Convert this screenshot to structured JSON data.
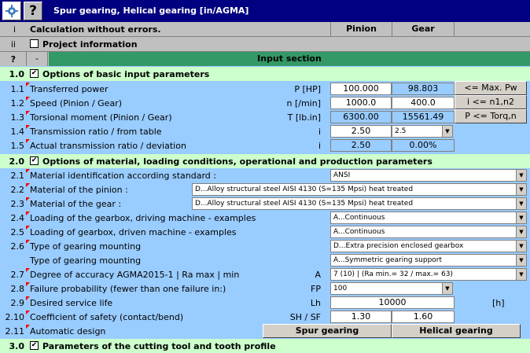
{
  "window": {
    "title": "Spur gearing, Helical gearing [in/AGMA]",
    "help_glyph": "?"
  },
  "status_row": {
    "num": "i",
    "text": "Calculation without errors.",
    "col_pinion": "Pinion",
    "col_gear": "Gear"
  },
  "project_row": {
    "num": "ii",
    "label": "Project information"
  },
  "input_row": {
    "num": "?",
    "dash": "-",
    "title": "Input section"
  },
  "section1": {
    "num": "1.0",
    "title": "Options of basic input parameters",
    "checked": "✔"
  },
  "rows1": [
    {
      "num": "1.1",
      "label": "Transferred power",
      "sym": "P [HP]",
      "pinion": "100.000",
      "gear": "98.803"
    },
    {
      "num": "1.2",
      "label": "Speed (Pinion / Gear)",
      "sym": "n [/min]",
      "pinion": "1000.0",
      "gear": "400.0"
    },
    {
      "num": "1.3",
      "label": "Torsional moment (Pinion / Gear)",
      "sym": "T [lb.in]",
      "pinion": "6300.00",
      "gear": "15561.49"
    },
    {
      "num": "1.4",
      "label": "Transmission ratio / from table",
      "sym": "i",
      "pinion": "2.50",
      "gear": "2.5"
    },
    {
      "num": "1.5",
      "label": "Actual transmission ratio / deviation",
      "sym": "i",
      "pinion": "2.50",
      "gear": "0.00%"
    }
  ],
  "side_buttons": [
    "<= Max. Pw",
    "i <= n1,n2",
    "P <= Torq,n"
  ],
  "section2": {
    "num": "2.0",
    "title": "Options of material, loading conditions, operational and production parameters",
    "checked": "✔"
  },
  "rows2": [
    {
      "num": "2.1",
      "label": "Material identification according standard :",
      "value": "ANSI"
    },
    {
      "num": "2.2",
      "label": "Material of the pinion :",
      "value": "D...Alloy structural steel AISI 4130  (S=135 Mpsi) heat treated"
    },
    {
      "num": "2.3",
      "label": "Material of the gear :",
      "value": "D...Alloy structural steel AISI 4130  (S=135 Mpsi) heat treated"
    },
    {
      "num": "2.4",
      "label": "Loading of the gearbox, driving machine - examples",
      "value": "A...Continuous"
    },
    {
      "num": "2.5",
      "label": "Loading of gearbox, driven machine - examples",
      "value": "A...Continuous"
    },
    {
      "num": "2.6",
      "label": "Type of gearing mounting",
      "value": "D...Extra precision enclosed gearbox"
    },
    {
      "num": "",
      "label": "Type of gearing mounting",
      "value": "A...Symmetric gearing support"
    },
    {
      "num": "2.7",
      "label": "Degree of accuracy AGMA2015-1 | Ra max | min",
      "sym": "A",
      "value": "7 (10)   |   (Ra min.= 32 / max.= 63)"
    },
    {
      "num": "2.8",
      "label": "Failure probability (fewer than one failure in:)",
      "sym": "FP",
      "value": "100"
    },
    {
      "num": "2.9",
      "label": "Desired service life",
      "sym": "Lh",
      "value": "10000",
      "unit": "[h]"
    },
    {
      "num": "2.10",
      "label": "Coefficient of safety (contact/bend)",
      "sym": "SH / SF",
      "pinion": "1.30",
      "gear": "1.60"
    },
    {
      "num": "2.11",
      "label": "Automatic design",
      "btn_spur": "Spur gearing",
      "btn_helical": "Helical gearing"
    }
  ],
  "section3": {
    "num": "3.0",
    "title": "Parameters of the cutting tool and tooth profile",
    "checked": "✔"
  }
}
